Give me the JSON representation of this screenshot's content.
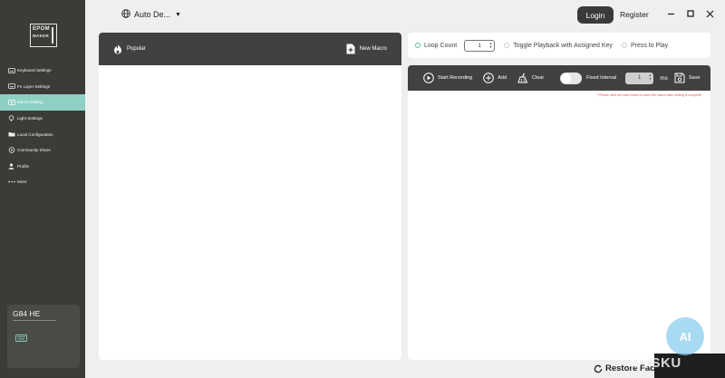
{
  "sidebar": {
    "logo": [
      "EPOM",
      "MAKER"
    ],
    "items": [
      {
        "label": "Keyboard Settings",
        "icon": "keyboard-icon",
        "active": false
      },
      {
        "label": "Fn Layer Settings",
        "icon": "keyboard-icon",
        "active": false
      },
      {
        "label": "Macro Editing",
        "icon": "macro-icon",
        "active": true
      },
      {
        "label": "Light Settings",
        "icon": "light-icon",
        "active": false
      },
      {
        "label": "Local Configuration",
        "icon": "folder-icon",
        "active": false
      },
      {
        "label": "Community Share",
        "icon": "share-icon",
        "active": false
      },
      {
        "label": "Profile",
        "icon": "user-icon",
        "active": false
      },
      {
        "label": "More",
        "icon": "more-icon",
        "active": false
      }
    ],
    "device": {
      "name": "G84 HE"
    }
  },
  "header": {
    "language": "Auto De...",
    "login_label": "Login",
    "register_label": "Register"
  },
  "macro_list": {
    "tab_label": "Popular",
    "new_macro_label": "New Macro"
  },
  "options": {
    "loop_count_label": "Loop Count",
    "loop_count_value": "1",
    "toggle_playback_label": "Toggle Playback with Assigned Key",
    "press_to_play_label": "Press to Play"
  },
  "editor": {
    "start_recording_label": "Start Recording",
    "add_label": "Add",
    "clear_label": "Clear",
    "fixed_interval_label": "Fixed Interval",
    "interval_value": "1",
    "ms_label": "ms",
    "save_label": "Save",
    "warning": "* Please click the save button to save the macro after setting is complete"
  },
  "footer": {
    "restore_label": "Restore Fact"
  },
  "watermark": {
    "text": "MYSKU",
    "badge": "AI"
  },
  "colors": {
    "accent": "#8ed1c4",
    "sidebar_bg": "#3b3b37",
    "panel_header": "#414141",
    "warning": "#e05a4f"
  }
}
